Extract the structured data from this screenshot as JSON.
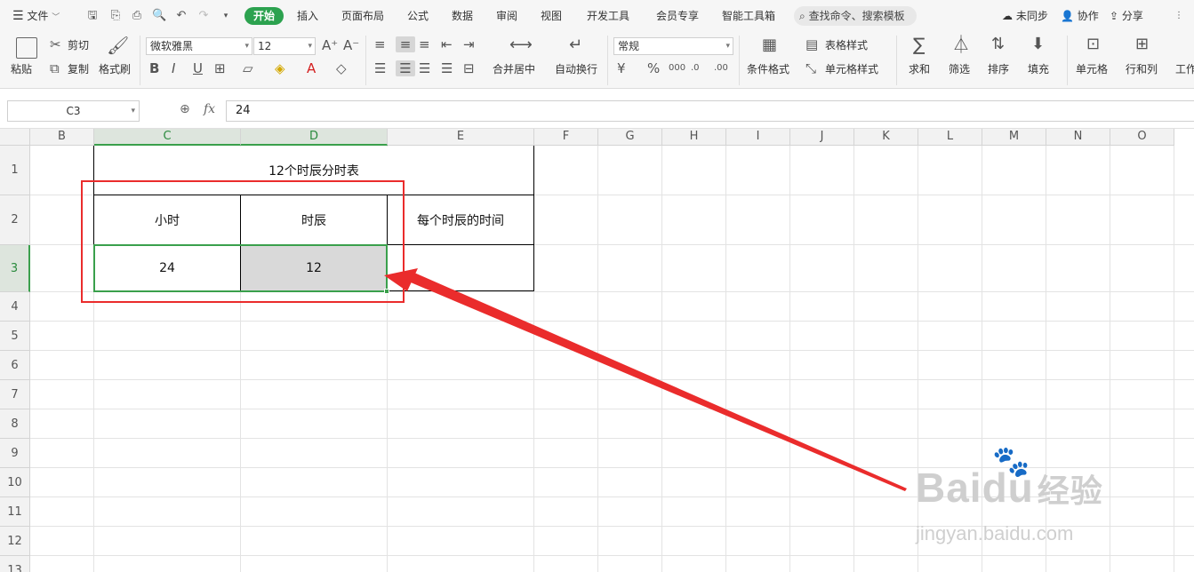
{
  "menubar": {
    "file_menu": "文件",
    "tabs": [
      "开始",
      "插入",
      "页面布局",
      "公式",
      "数据",
      "审阅",
      "视图",
      "开发工具",
      "会员专享",
      "智能工具箱"
    ],
    "active_tab": "开始",
    "search_placeholder": "查找命令、搜索模板",
    "sync_status": "未同步",
    "collab": "协作",
    "share": "分享"
  },
  "ribbon": {
    "paste": "粘贴",
    "cut": "剪切",
    "copy": "复制",
    "format_painter": "格式刷",
    "font_name": "微软雅黑",
    "font_size": "12",
    "merge_center": "合并居中",
    "wrap_text": "自动换行",
    "number_format": "常规",
    "conditional_format": "条件格式",
    "table_style": "表格样式",
    "cell_style": "单元格样式",
    "sum": "求和",
    "filter": "筛选",
    "sort": "排序",
    "fill": "填充",
    "cell": "单元格",
    "row_col": "行和列",
    "worksheet": "工作"
  },
  "formula_bar": {
    "cell_ref": "C3",
    "fx": "fx",
    "value": "24"
  },
  "sheet": {
    "columns": [
      "B",
      "C",
      "D",
      "E",
      "F",
      "G",
      "H",
      "I",
      "J",
      "K",
      "L",
      "M",
      "N",
      "O"
    ],
    "rows": [
      "1",
      "2",
      "3",
      "4",
      "5",
      "6",
      "7",
      "8",
      "9",
      "10",
      "11",
      "12",
      "13"
    ],
    "title": "12个时辰分时表",
    "header_hours": "小时",
    "header_shichen": "时辰",
    "header_each": "每个时辰的时间",
    "value_hours": "24",
    "value_shichen": "12"
  },
  "watermark": {
    "brand": "Baidu",
    "brand_cn": "经验",
    "url": "jingyan.baidu.com"
  },
  "colors": {
    "accent": "#2ca24f",
    "selection": "#3aa04c",
    "annotation": "#ea2c2c"
  }
}
